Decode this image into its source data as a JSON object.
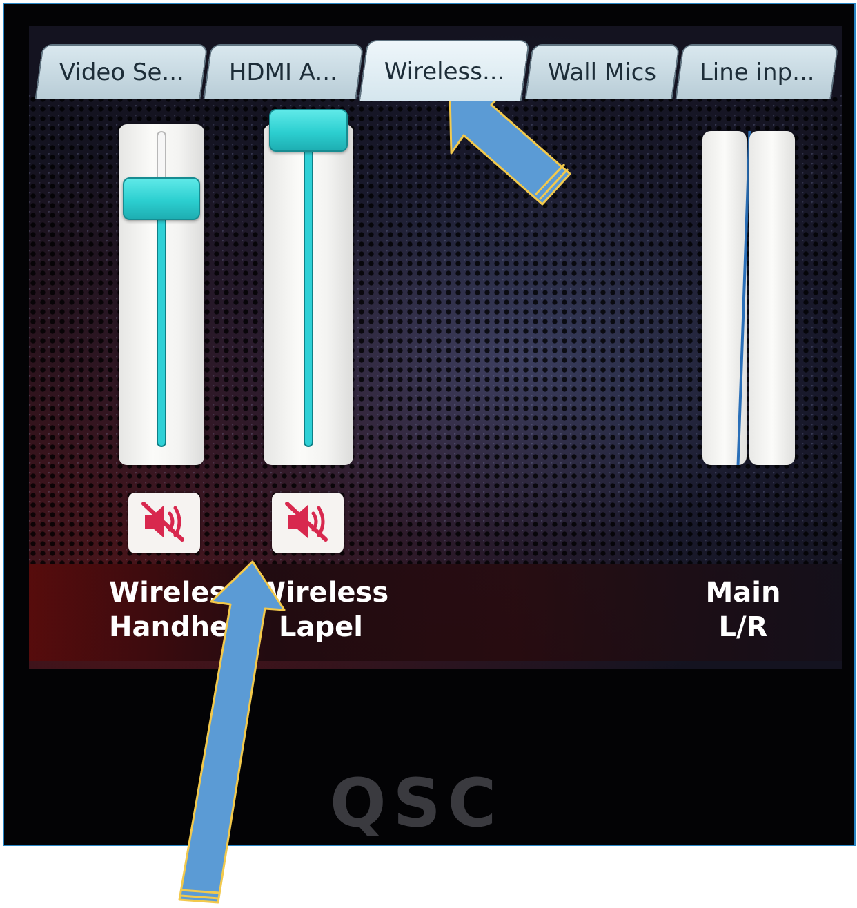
{
  "tabs": [
    {
      "label": "Video Se...",
      "active": false
    },
    {
      "label": "HDMI A...",
      "active": false
    },
    {
      "label": "Wireless...",
      "active": true
    },
    {
      "label": "Wall Mics",
      "active": false
    },
    {
      "label": "Line inp...",
      "active": false
    }
  ],
  "channels": [
    {
      "name_line1": "Wireles",
      "name_line2": "Handhe",
      "fader_level": 0.84,
      "muted": true
    },
    {
      "name_line1": "Wireless",
      "name_line2": "Lapel",
      "fader_level": 1.0,
      "muted": true
    }
  ],
  "main_output": {
    "name_line1": "Main",
    "name_line2": "L/R",
    "meter_level": 0.0
  },
  "brand": {
    "logo_text": "QSC"
  },
  "icons": {
    "mute": "speaker-muted-icon",
    "annotation_arrow": "arrow-icon"
  },
  "colors": {
    "fader_accent": "#2fd0d6",
    "mute_icon": "#d8284e",
    "arrow_fill": "#5b9bd5",
    "arrow_outline": "#f2c94c",
    "frame_border": "#2a86c4"
  }
}
